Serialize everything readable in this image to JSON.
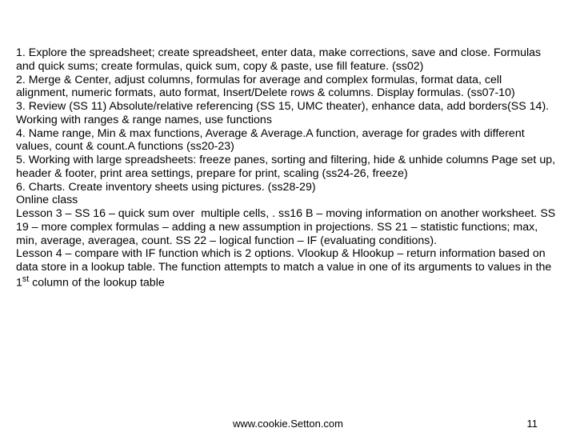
{
  "body_html": "1. Explore the spreadsheet; create spreadsheet, enter data, make corrections, save and close. Formulas and quick sums; create formulas, quick sum, copy &amp; paste, use fill feature. (ss02)\n2. Merge &amp; Center, adjust columns, formulas for average and complex formulas, format data, cell alignment, numeric formats, auto format, Insert/Delete rows &amp; columns. Display formulas. (ss07-10)\n3. Review (SS 11) Absolute/relative referencing (SS 15, UMC theater), enhance data, add borders(SS 14). Working with ranges &amp; range names, use functions\n4. Name range, Min &amp; max functions, Average &amp; Average.A function, average for grades with different values, count &amp; count.A functions (ss20-23)\n5. Working with large spreadsheets: freeze panes, sorting and filtering, hide &amp; unhide columns Page set up, header &amp; footer, print area settings, prepare for print, scaling (ss24-26, freeze)\n6. Charts. Create inventory sheets using pictures. (ss28-29)\nOnline class\nLesson 3 – SS 16 – quick sum over  multiple cells, . ss16 B – moving information on another worksheet. SS 19 – more complex formulas – adding a new assumption in projections. SS 21 – statistic functions; max, min, average, averagea, count. SS 22 – logical function – IF (evaluating conditions).\nLesson 4 – compare with IF function which is 2 options. Vlookup &amp; Hlookup – return information based on data store in a lookup table. The function attempts to match a value in one of its arguments to values in the 1<sup>st</sup> column of the lookup table",
  "footer": {
    "url": "www.cookie.Setton.com",
    "page": "11"
  }
}
